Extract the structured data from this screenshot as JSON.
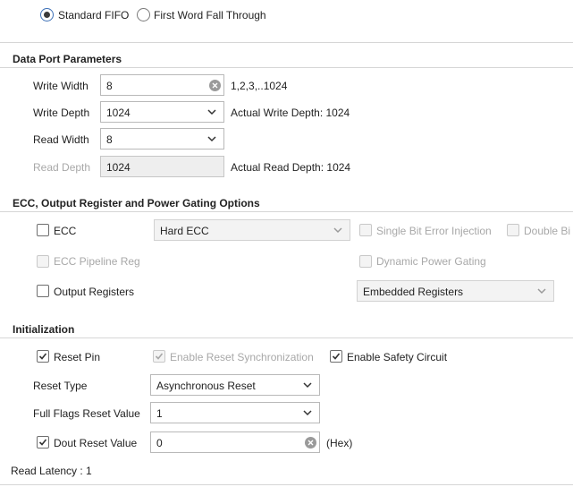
{
  "fifo_mode": {
    "options": [
      "Standard FIFO",
      "First Word Fall Through"
    ],
    "selected": "Standard FIFO"
  },
  "data_port": {
    "title": "Data Port Parameters",
    "write_width": {
      "label": "Write Width",
      "value": "8",
      "hint": "1,2,3,..1024"
    },
    "write_depth": {
      "label": "Write Depth",
      "value": "1024",
      "hint": "Actual Write Depth: 1024"
    },
    "read_width": {
      "label": "Read Width",
      "value": "8"
    },
    "read_depth": {
      "label": "Read Depth",
      "value": "1024",
      "hint": "Actual Read Depth: 1024"
    }
  },
  "ecc_section": {
    "title": "ECC, Output Register and Power Gating Options",
    "ecc": {
      "label": "ECC",
      "checked": false
    },
    "ecc_type": {
      "value": "Hard ECC"
    },
    "single_bit": {
      "label": "Single Bit Error Injection",
      "checked": false
    },
    "double_bit": {
      "label": "Double Bi",
      "checked": false
    },
    "ecc_pipeline": {
      "label": "ECC Pipeline Reg",
      "checked": false
    },
    "dynamic_power": {
      "label": "Dynamic Power Gating",
      "checked": false
    },
    "output_registers": {
      "label": "Output Registers",
      "checked": false
    },
    "register_type": {
      "value": "Embedded Registers"
    }
  },
  "initialization": {
    "title": "Initialization",
    "reset_pin": {
      "label": "Reset Pin",
      "checked": true
    },
    "reset_sync": {
      "label": "Enable Reset Synchronization",
      "checked": true
    },
    "safety_circuit": {
      "label": "Enable Safety Circuit",
      "checked": true
    },
    "reset_type": {
      "label": "Reset Type",
      "value": "Asynchronous Reset"
    },
    "full_flags": {
      "label": "Full Flags Reset Value",
      "value": "1"
    },
    "dout_reset": {
      "label": "Dout Reset Value",
      "checked": true,
      "value": "0",
      "unit": "(Hex)"
    },
    "read_latency": "Read Latency : 1"
  },
  "colors": {
    "radio_ring": "#3b6fb6",
    "border": "#b9b9b9",
    "disabled_text": "#a8a8a8"
  }
}
